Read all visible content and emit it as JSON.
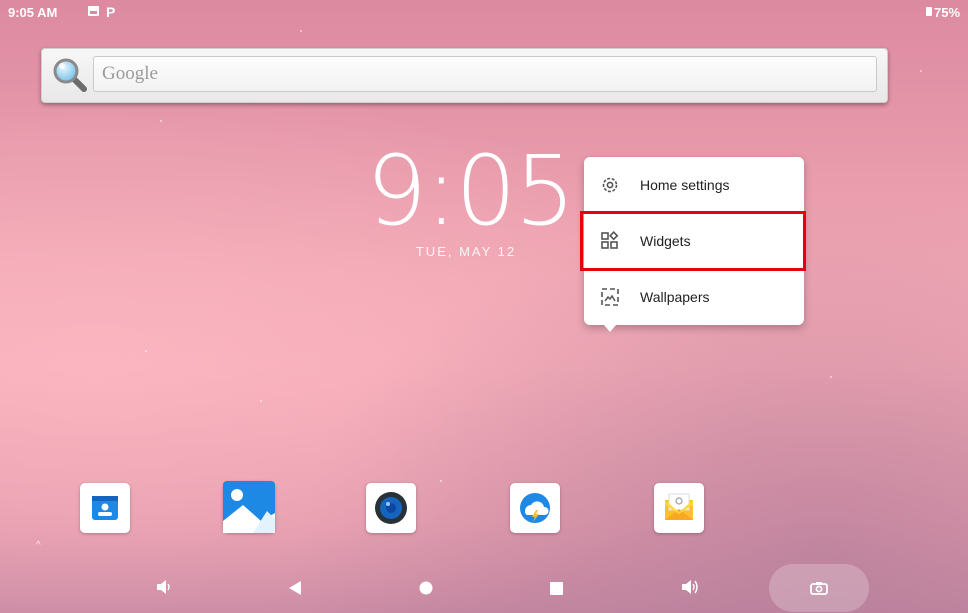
{
  "status_bar": {
    "time": "9:05 AM",
    "notification_icons": [
      "image-icon",
      "p-icon"
    ],
    "p_glyph": "P",
    "battery": "75%"
  },
  "search": {
    "placeholder": "Google"
  },
  "clock": {
    "time": "9:05",
    "date": "TUE, MAY 12"
  },
  "context_menu": {
    "items": [
      {
        "label": "Home settings",
        "icon": "gear-icon"
      },
      {
        "label": "Widgets",
        "icon": "widgets-icon"
      },
      {
        "label": "Wallpapers",
        "icon": "wallpaper-icon"
      }
    ],
    "highlighted": "Widgets",
    "highlight_color": "#e8000b"
  },
  "dock": {
    "apps": [
      {
        "icon": "contacts-icon"
      },
      {
        "icon": "gallery-icon"
      },
      {
        "icon": "music-icon"
      },
      {
        "icon": "weather-icon"
      },
      {
        "icon": "email-icon"
      }
    ]
  },
  "nav_bar": {
    "buttons": [
      "volume-down-icon",
      "back-icon",
      "home-icon",
      "recents-icon",
      "volume-up-icon",
      "screenshot-icon"
    ]
  },
  "colors": {
    "wallpaper_top": "#dc8aa0",
    "wallpaper_mid": "#f4a9b5",
    "accent_blue": "#1e88e5"
  }
}
